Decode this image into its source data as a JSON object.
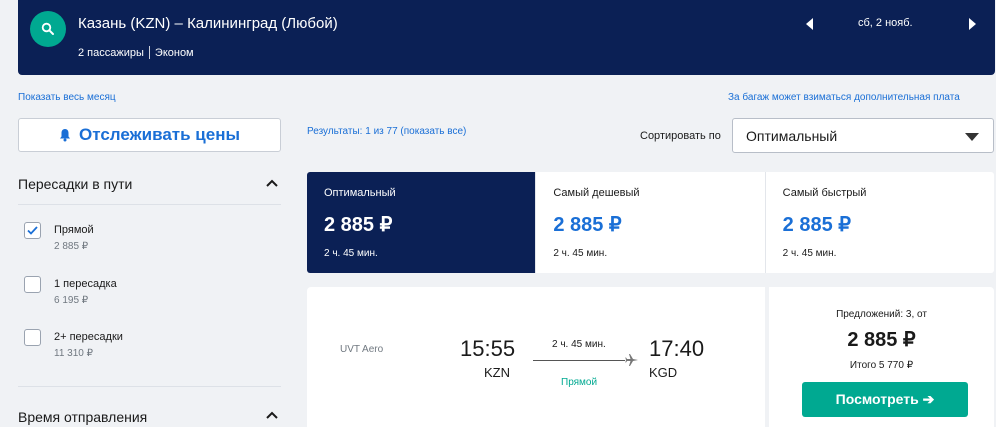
{
  "header": {
    "route": "Казань (KZN) – Калининград (Любой)",
    "passengers": "2 пассажиры",
    "cabin": "Эконом",
    "date": "сб, 2 нояб."
  },
  "links": {
    "show_month": "Показать весь месяц",
    "baggage_note": "За багаж может взиматься дополнительная плата"
  },
  "track_button": {
    "label": "Отслеживать цены"
  },
  "filters": {
    "stops": {
      "title": "Пересадки в пути",
      "options": [
        {
          "label": "Прямой",
          "price": "2 885 ₽",
          "checked": true
        },
        {
          "label": "1 пересадка",
          "price": "6 195 ₽",
          "checked": false
        },
        {
          "label": "2+ пересадки",
          "price": "11 310 ₽",
          "checked": false
        }
      ]
    },
    "departure": {
      "title": "Время отправления"
    }
  },
  "results": {
    "text": "Результаты: 1 из 77 (показать все)"
  },
  "sort": {
    "label": "Сортировать по",
    "selected": "Оптимальный"
  },
  "tabs": [
    {
      "name": "Оптимальный",
      "price": "2 885 ₽",
      "duration": "2 ч. 45 мин.",
      "active": true
    },
    {
      "name": "Самый дешевый",
      "price": "2 885 ₽",
      "duration": "2 ч. 45 мин.",
      "active": false
    },
    {
      "name": "Самый быстрый",
      "price": "2 885 ₽",
      "duration": "2 ч. 45 мин.",
      "active": false
    }
  ],
  "flight": {
    "airline": "UVT Aero",
    "dep_time": "15:55",
    "dep_airport": "KZN",
    "arr_time": "17:40",
    "arr_airport": "KGD",
    "duration": "2 ч. 45 мин.",
    "stops": "Прямой"
  },
  "offer": {
    "offers_text": "Предложений: 3, от",
    "price": "2 885 ₽",
    "total": "Итого 5 770 ₽",
    "button": "Посмотреть ➔"
  },
  "colors": {
    "navy": "#0b2055",
    "teal": "#00a991",
    "blue": "#1a6fd6"
  }
}
